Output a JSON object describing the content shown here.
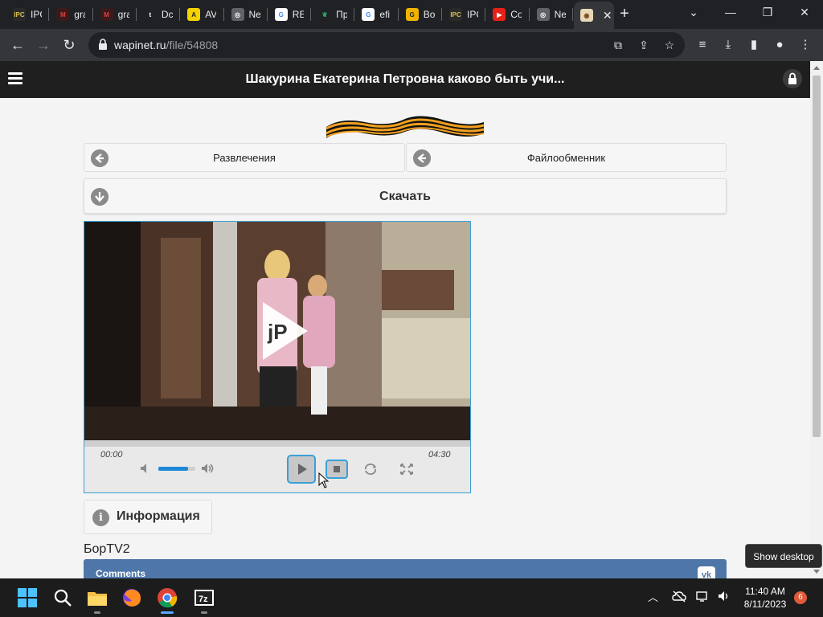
{
  "browser": {
    "tabs": [
      {
        "title": "IPC",
        "icon": "ipc-games-icon"
      },
      {
        "title": "gra",
        "icon": "media-icon"
      },
      {
        "title": "gra",
        "icon": "media-icon"
      },
      {
        "title": "Dc",
        "icon": "tumblr-icon"
      },
      {
        "title": "AV",
        "icon": "yellow-a-icon"
      },
      {
        "title": "Ne",
        "icon": "chrome-icon"
      },
      {
        "title": "RE",
        "icon": "google-icon"
      },
      {
        "title": "Пр",
        "icon": "leaf-icon"
      },
      {
        "title": "efi",
        "icon": "google-icon"
      },
      {
        "title": "Bo",
        "icon": "yellow-g-icon"
      },
      {
        "title": "IPC",
        "icon": "ipc-games-icon"
      },
      {
        "title": "Co",
        "icon": "youtube-icon"
      },
      {
        "title": "Ne",
        "icon": "chrome-icon"
      },
      {
        "title": "",
        "icon": "eye-icon",
        "active": true
      }
    ],
    "url_host": "wapinet.ru",
    "url_path": "/file/54808"
  },
  "page": {
    "header_title": "Шакурина Екатерина Петровна каково быть учи...",
    "nav_left": "Развлечения",
    "nav_right": "Файлообменник",
    "download": "Скачать",
    "player": {
      "time_current": "00:00",
      "time_total": "04:30",
      "volume": 0.8,
      "progress": 0.0
    },
    "info_label": "Информация",
    "author": "БорTV2",
    "comments_label": "Comments",
    "vk_label": "vk"
  },
  "tooltip": "Show desktop",
  "taskbar": {
    "time": "11:40 AM",
    "date": "8/11/2023",
    "notifications": "6"
  }
}
